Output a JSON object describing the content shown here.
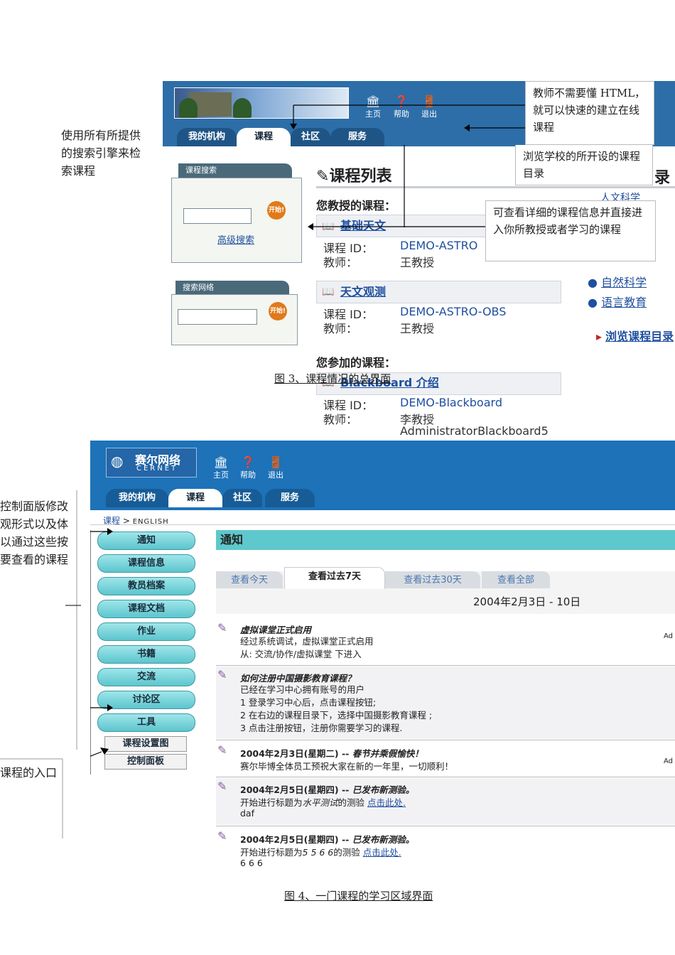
{
  "fig3": {
    "top_icons": [
      "主页",
      "帮助",
      "退出"
    ],
    "tabs": [
      "我的机构",
      "课程",
      "社区",
      "服务"
    ],
    "search_box": {
      "title": "课程搜索",
      "go": "开始!",
      "advanced": "高级搜索"
    },
    "web_search": {
      "title": "搜索网络",
      "go": "开始!"
    },
    "page_title": "课程列表",
    "title_fragment": "录",
    "teaching_heading": "您教授的课程：",
    "enrolled_heading": "您参加的课程：",
    "label_course_id": "课程 ID：",
    "label_teacher": "教师：",
    "courses": [
      {
        "name": "基础天文",
        "id": "DEMO-ASTRO",
        "teacher": "王教授"
      },
      {
        "name": "天文观测",
        "id": "DEMO-ASTRO-OBS",
        "teacher": "王教授"
      },
      {
        "name": "Blackboard 介绍",
        "id": "DEMO-Blackboard",
        "teacher": "李教授",
        "teacher2": "AdministratorBlackboard5"
      }
    ],
    "right_links": [
      "人文科学",
      "自然科学",
      "语言教育",
      "浏览课程目录"
    ],
    "callouts": {
      "html": "教师不需要懂 HTML，就可以快速的建立在线课程",
      "catalog": "浏览学校的所开设的课程目录",
      "detail": "可查看详细的课程信息并直接进入你所教授或者学习的课程"
    },
    "left_annotation": "使用所有所提供的搜索引擎来检索课程",
    "caption": "图 3、课程情况的总界面"
  },
  "fig4": {
    "logo_cn": "赛尔网络",
    "logo_en": "CERNET",
    "top_icons": [
      "主页",
      "帮助",
      "退出"
    ],
    "tabs": [
      "我的机构",
      "课程",
      "社区",
      "服务"
    ],
    "breadcrumb": {
      "link": "课程",
      "sep": ">",
      "current": "ENGLISH"
    },
    "nav": [
      "通知",
      "课程信息",
      "教员档案",
      "课程文档",
      "作业",
      "书籍",
      "交流",
      "讨论区",
      "工具"
    ],
    "nav_square": [
      "课程设置图",
      "控制面板"
    ],
    "section_title": "通知",
    "subtabs": [
      "查看今天",
      "查看过去7天",
      "查看过去30天",
      "查看全部"
    ],
    "date_range": "2004年2月3日 - 10日",
    "notes": [
      {
        "title": "虚拟课堂正式启用",
        "lines": [
          "经过系统调试，虚拟课堂正式启用",
          "从: 交流/协作/虚拟课堂  下进入"
        ],
        "right": "Ad"
      },
      {
        "title": "如何注册中国摄影教育课程？",
        "lines": [
          "已经在学习中心拥有账号的用户",
          "1 登录学习中心后，点击课程按钮;",
          "2 在右边的课程目录下，选择中国摄影教育课程 ;",
          "3 点击注册按钮，注册你需要学习的课程."
        ],
        "right": ""
      },
      {
        "date": "2004年2月3日(星期二) --",
        "title": "春节并乘假愉快！",
        "lines": [
          "赛尔毕博全体员工预祝大家在新的一年里，一切顺利！"
        ],
        "right": "Ad"
      },
      {
        "date": "2004年2月5日(星期四) --",
        "title": "已发布新测验。",
        "lines": [
          "开始进行标题为",
          "daf"
        ],
        "italic": "水平测试",
        "suffix": "的测验",
        "link": "点击此处.",
        "right": ""
      },
      {
        "date": "2004年2月5日(星期四) --",
        "title": "已发布新测验。",
        "lines": [
          "开始进行标题为",
          "6 6 6"
        ],
        "italic": "5 5 6 6",
        "suffix": "的测验",
        "link": "点击此处.",
        "right": ""
      }
    ],
    "left_annotation": [
      "控制面版修改",
      "观形式以及体",
      "以通过这些按",
      "要查看的课程"
    ],
    "left_annotation2": "课程的入口",
    "caption": "图 4、一门课程的学习区域界面"
  }
}
